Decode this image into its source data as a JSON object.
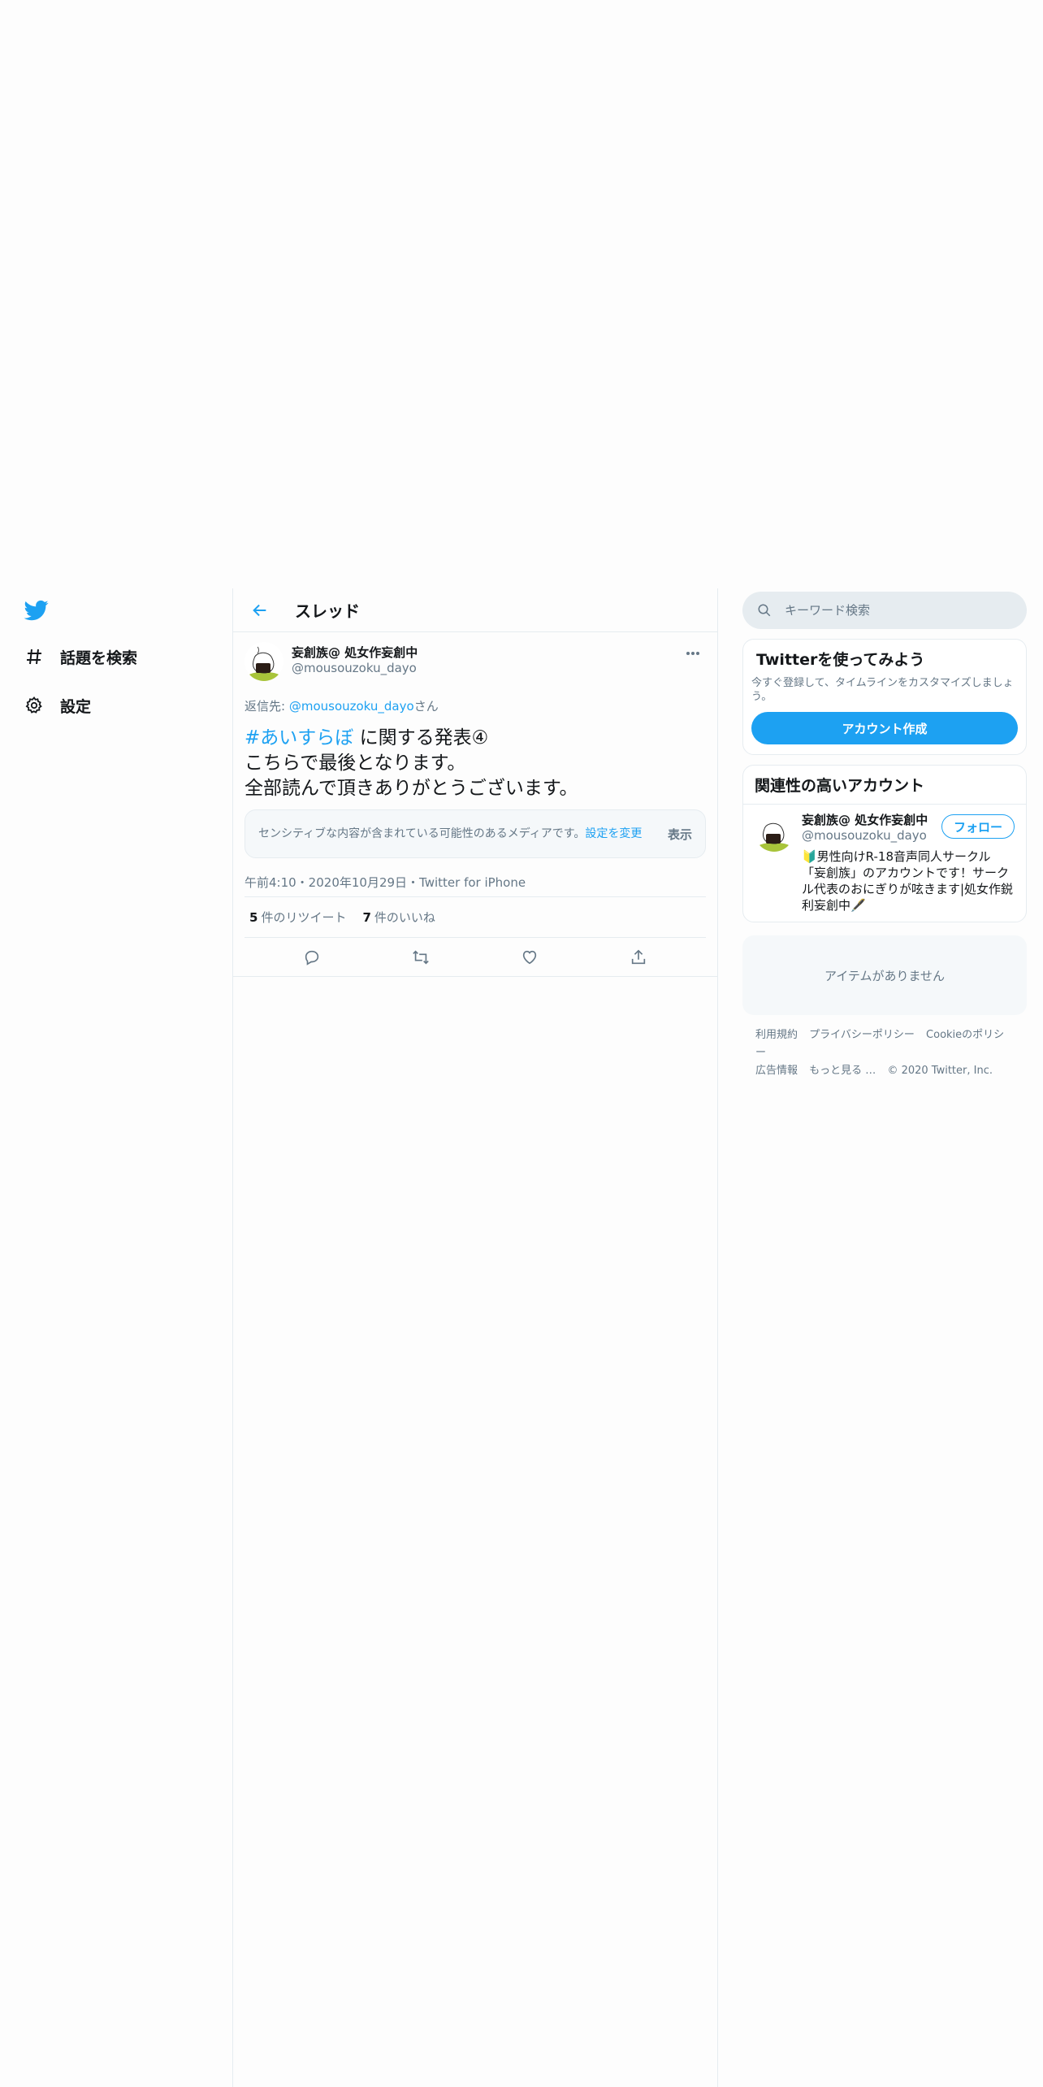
{
  "nav": {
    "items": [
      {
        "label": "話題を検索"
      },
      {
        "label": "設定"
      }
    ]
  },
  "header": {
    "title": "スレッド"
  },
  "tweet": {
    "display_name": "妄創族@ 処女作妄創中",
    "handle": "@mousouzoku_dayo",
    "reply_prefix": "返信先: ",
    "reply_mention": "@mousouzoku_dayo",
    "reply_suffix": "さん",
    "hashtag": "#あいすらぼ",
    "text_line1_rest": " に関する発表④",
    "text_line2": "こちらで最後となります。",
    "text_line3": "全部読んで頂きありがとうございます。",
    "sensitive_msg": "センシティブな内容が含まれている可能性のあるメディアです。",
    "sensitive_link": "設定を変更",
    "show_label": "表示",
    "timestamp": "午前4:10・2020年10月29日・Twitter for iPhone",
    "retweet_count": "5",
    "retweet_label": "件のリツイート",
    "like_count": "7",
    "like_label": "件のいいね"
  },
  "search": {
    "placeholder": "キーワード検索"
  },
  "signup": {
    "title": "Twitterを使ってみよう",
    "subtitle": "今すぐ登録して、タイムラインをカスタマイズしましょう。",
    "button": "アカウント作成"
  },
  "related": {
    "title": "関連性の高いアカウント",
    "user": {
      "display_name": "妄創族@ 処女作妄創中",
      "handle": "@mousouzoku_dayo",
      "follow": "フォロー",
      "bio": "🔰男性向けR-18音声同人サークル「妄創族」のアカウントです！サークル代表のおにぎりが呟きます|処女作鋭利妄創中🖋️"
    }
  },
  "trends": {
    "empty": "アイテムがありません"
  },
  "footer": {
    "links": [
      "利用規約",
      "プライバシーポリシー",
      "Cookieのポリシー",
      "広告情報",
      "もっと見る …"
    ],
    "copyright": "© 2020 Twitter, Inc."
  },
  "colors": {
    "accent": "#1da1f2",
    "secondary_text": "#657786",
    "border": "#e6ecf0"
  }
}
